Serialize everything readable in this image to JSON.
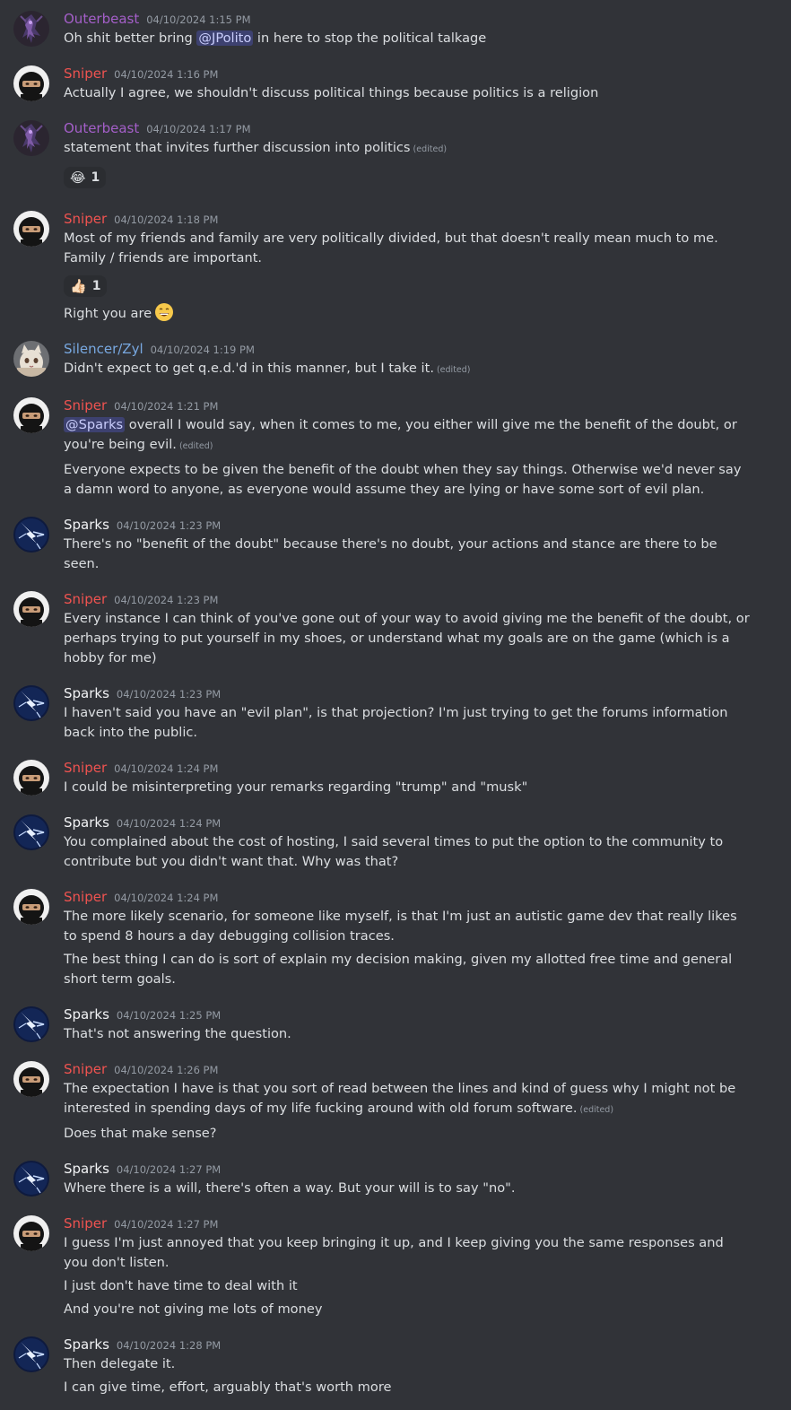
{
  "colors": {
    "background": "#313338",
    "outerbeast": "#a45fc9",
    "sniper": "#ef5350",
    "silencer": "#78a8e0",
    "sparks": "#f2f3f5",
    "mention_bg": "#3c4270"
  },
  "edited_label": "(edited)",
  "messages": [
    {
      "user": "Outerbeast",
      "time": "04/10/2024 1:15 PM",
      "avatar": "dragon-avatar-icon",
      "line1_pre": "Oh shit better bring ",
      "line1_mention": "@JPolito",
      "line1_post": " in here to stop the political talkage"
    },
    {
      "user": "Sniper",
      "time": "04/10/2024 1:16 PM",
      "avatar": "ninja-avatar-icon",
      "line1": "Actually I agree, we shouldn't discuss political things because politics is a religion"
    },
    {
      "user": "Outerbeast",
      "time": "04/10/2024 1:17 PM",
      "avatar": "dragon-avatar-icon",
      "line1": "statement that invites further discussion into politics",
      "reaction_emoji": "😂",
      "reaction_count": "1"
    },
    {
      "user": "Sniper",
      "time": "04/10/2024 1:18 PM",
      "avatar": "ninja-avatar-icon",
      "line1": "Most of my friends and family are very politically divided, but that doesn't really mean much to me. Family / friends are important.",
      "reaction_emoji": "👍🏻",
      "reaction_count": "1",
      "line2": "Right you are"
    },
    {
      "user": "Silencer/Zyl",
      "time": "04/10/2024 1:19 PM",
      "avatar": "cat-avatar-icon",
      "line1": "Didn't expect to get q.e.d.'d in this manner, but I take it."
    },
    {
      "user": "Sniper",
      "time": "04/10/2024 1:21 PM",
      "avatar": "ninja-avatar-icon",
      "line1_mention": "@Sparks",
      "line1_post": " overall I would say, when it comes to me, you either will give me the benefit of the doubt, or you're being evil.",
      "line2": "Everyone expects to be given the benefit of the doubt when they say things. Otherwise we'd never say a damn word to anyone, as everyone would assume they are lying or have some sort of evil plan."
    },
    {
      "user": "Sparks",
      "time": "04/10/2024 1:23 PM",
      "avatar": "lightning-avatar-icon",
      "line1": "There's no \"benefit of the doubt\" because there's no doubt, your actions and stance are there to be seen."
    },
    {
      "user": "Sniper",
      "time": "04/10/2024 1:23 PM",
      "avatar": "ninja-avatar-icon",
      "line1": "Every instance I can think of you've gone out of your way to avoid giving me the benefit of the doubt, or perhaps trying to put yourself in my shoes, or understand what my goals are on the game (which is a hobby for me)"
    },
    {
      "user": "Sparks",
      "time": "04/10/2024 1:23 PM",
      "avatar": "lightning-avatar-icon",
      "line1": "I haven't said you have an \"evil plan\", is that projection? I'm just trying to get the forums information back into the public."
    },
    {
      "user": "Sniper",
      "time": "04/10/2024 1:24 PM",
      "avatar": "ninja-avatar-icon",
      "line1": "I could be misinterpreting your remarks regarding \"trump\" and \"musk\""
    },
    {
      "user": "Sparks",
      "time": "04/10/2024 1:24 PM",
      "avatar": "lightning-avatar-icon",
      "line1": "You complained about the cost of hosting, I said several times to put the option to the community to contribute but you didn't want that. Why was that?"
    },
    {
      "user": "Sniper",
      "time": "04/10/2024 1:24 PM",
      "avatar": "ninja-avatar-icon",
      "line1": "The more likely scenario, for someone like myself, is that I'm just an autistic game dev that really likes to spend 8 hours a day debugging collision traces.",
      "line2": "The best thing I can do is sort of explain my decision making, given my allotted free time and general short term goals."
    },
    {
      "user": "Sparks",
      "time": "04/10/2024 1:25 PM",
      "avatar": "lightning-avatar-icon",
      "line1": "That's not answering the question."
    },
    {
      "user": "Sniper",
      "time": "04/10/2024 1:26 PM",
      "avatar": "ninja-avatar-icon",
      "line1": "The expectation I have is that you sort of read between the lines and kind of guess why I might not be interested in spending days of my life fucking around with old forum software.",
      "line2": "Does that make sense?"
    },
    {
      "user": "Sparks",
      "time": "04/10/2024 1:27 PM",
      "avatar": "lightning-avatar-icon",
      "line1": "Where there is a will, there's often a way. But your will is to say \"no\"."
    },
    {
      "user": "Sniper",
      "time": "04/10/2024 1:27 PM",
      "avatar": "ninja-avatar-icon",
      "line1": "I guess I'm just annoyed that you keep bringing it up, and I keep giving you the same responses and you don't listen.",
      "line2": "I just don't have time to deal with it",
      "line3": "And you're not giving me lots of money"
    },
    {
      "user": "Sparks",
      "time": "04/10/2024 1:28 PM",
      "avatar": "lightning-avatar-icon",
      "line1": "Then delegate it.",
      "line2": "I can give time, effort, arguably that's worth more"
    }
  ]
}
